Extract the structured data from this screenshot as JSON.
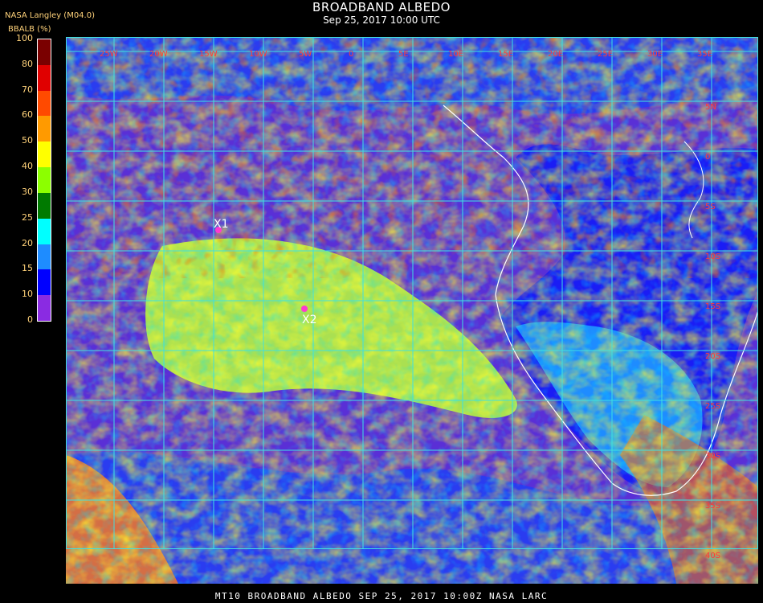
{
  "header": {
    "title": "BROADBAND ALBEDO",
    "subtitle": "Sep 25, 2017 10:00 UTC",
    "source": "NASA Langley (M04.0)",
    "unit_label": "BBALB (%)"
  },
  "colorbar": {
    "ticks": [
      "100",
      "80",
      "70",
      "60",
      "50",
      "40",
      "30",
      "25",
      "20",
      "15",
      "10",
      "0"
    ],
    "colors": [
      "#7a0000",
      "#e00000",
      "#ff4a00",
      "#ff9a00",
      "#ffff00",
      "#8cff00",
      "#007a00",
      "#00ffff",
      "#1e8cff",
      "#0000ff",
      "#8a2be2"
    ]
  },
  "map": {
    "lon_labels": [
      "25W",
      "20W",
      "15W",
      "10W",
      "5W",
      "0",
      "5E",
      "10E",
      "15E",
      "20E",
      "25E",
      "30E",
      "35E"
    ],
    "lat_labels": [
      "5N",
      "0",
      "5S",
      "10S",
      "15S",
      "20S",
      "25S",
      "30S",
      "35S",
      "40S"
    ],
    "markers": [
      {
        "label": "X1",
        "color": "#ff3ad0"
      },
      {
        "label": "X2",
        "color": "#ff3ad0"
      }
    ],
    "grid_color": "#40e0e0",
    "coastline_color": "#ffffff"
  },
  "footer": {
    "text": "MT10  BROADBAND ALBEDO   SEP 25, 2017 10:00Z   NASA LARC"
  }
}
